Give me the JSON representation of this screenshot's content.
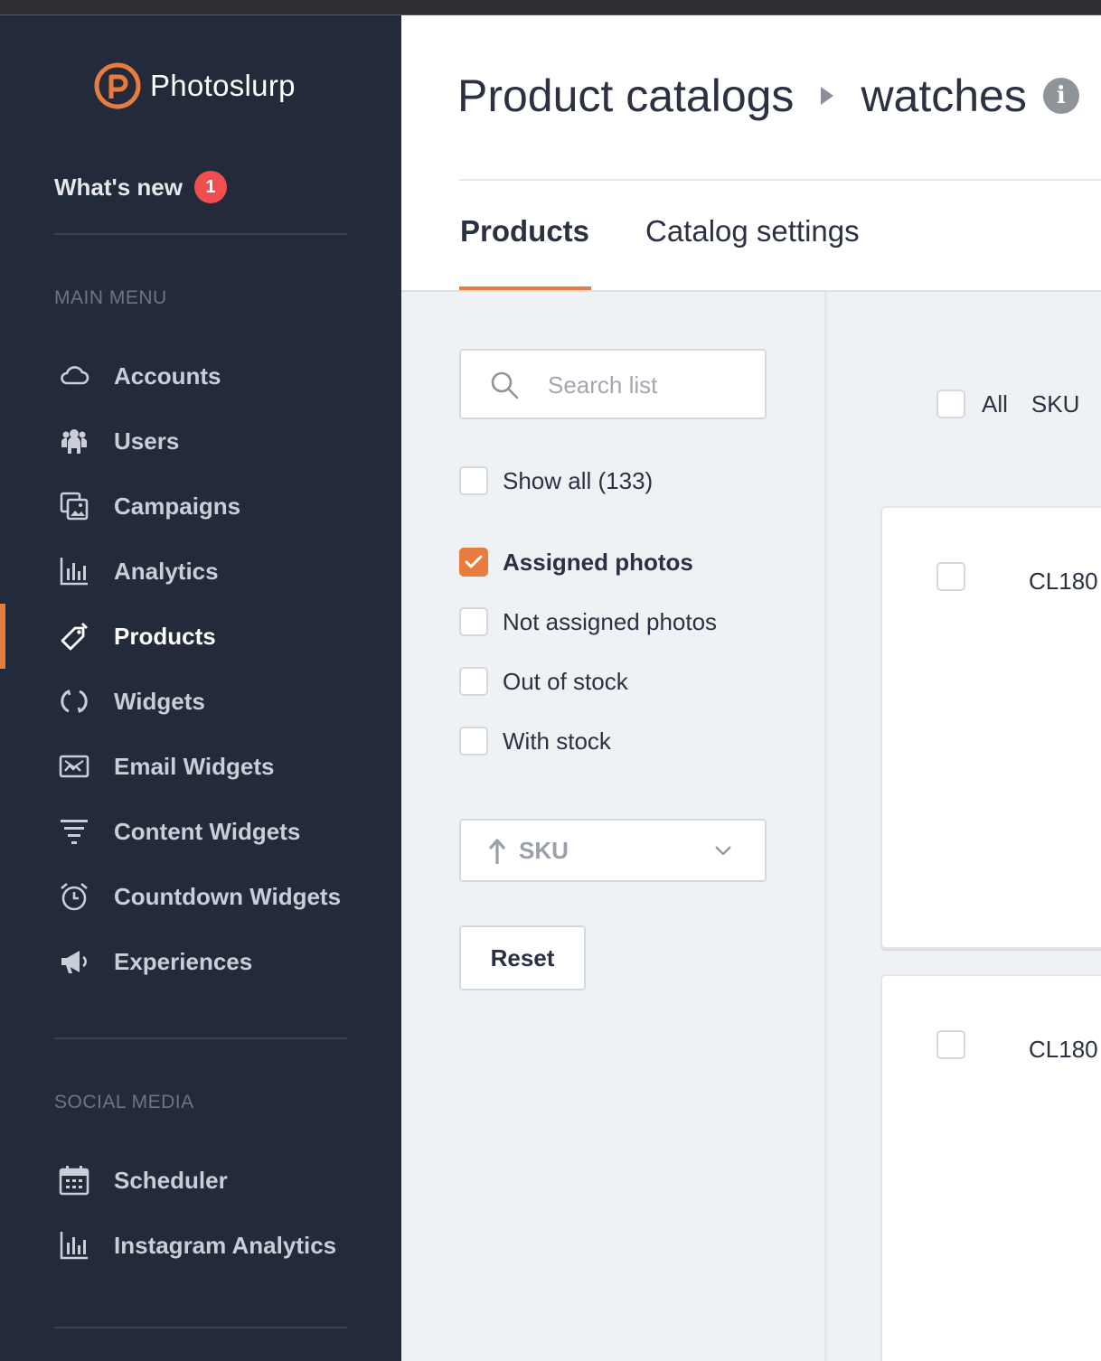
{
  "app": {
    "brand": "Photoslurp",
    "accent_color": "#e87c3e"
  },
  "sidebar": {
    "whats_new": {
      "label": "What's new",
      "count": "1"
    },
    "main_menu_label": "MAIN MENU",
    "main_items": [
      {
        "label": "Accounts",
        "icon": "cloud-icon"
      },
      {
        "label": "Users",
        "icon": "users-icon"
      },
      {
        "label": "Campaigns",
        "icon": "campaigns-icon"
      },
      {
        "label": "Analytics",
        "icon": "bar-chart-icon"
      },
      {
        "label": "Products",
        "icon": "tag-icon",
        "active": true
      },
      {
        "label": "Widgets",
        "icon": "widgets-icon"
      },
      {
        "label": "Email Widgets",
        "icon": "email-icon"
      },
      {
        "label": "Content Widgets",
        "icon": "filter-icon"
      },
      {
        "label": "Countdown Widgets",
        "icon": "alarm-clock-icon"
      },
      {
        "label": "Experiences",
        "icon": "megaphone-icon"
      }
    ],
    "social_label": "SOCIAL MEDIA",
    "social_items": [
      {
        "label": "Scheduler",
        "icon": "calendar-icon"
      },
      {
        "label": "Instagram Analytics",
        "icon": "bar-chart-icon"
      }
    ]
  },
  "header": {
    "breadcrumb": [
      "Product catalogs",
      "watches"
    ],
    "tabs": [
      {
        "label": "Products",
        "active": true
      },
      {
        "label": "Catalog settings",
        "active": false
      }
    ]
  },
  "filters": {
    "search_placeholder": "Search list",
    "show_all": "Show all (133)",
    "options": [
      {
        "label": "Assigned photos",
        "checked": true
      },
      {
        "label": "Not assigned photos",
        "checked": false
      },
      {
        "label": "Out of stock",
        "checked": false
      },
      {
        "label": "With stock",
        "checked": false
      }
    ],
    "sort_label": "SKU",
    "reset_label": "Reset"
  },
  "list": {
    "all_label": "All",
    "sku_label": "SKU",
    "rows": [
      {
        "sku": "CL180"
      },
      {
        "sku": "CL180"
      }
    ]
  }
}
